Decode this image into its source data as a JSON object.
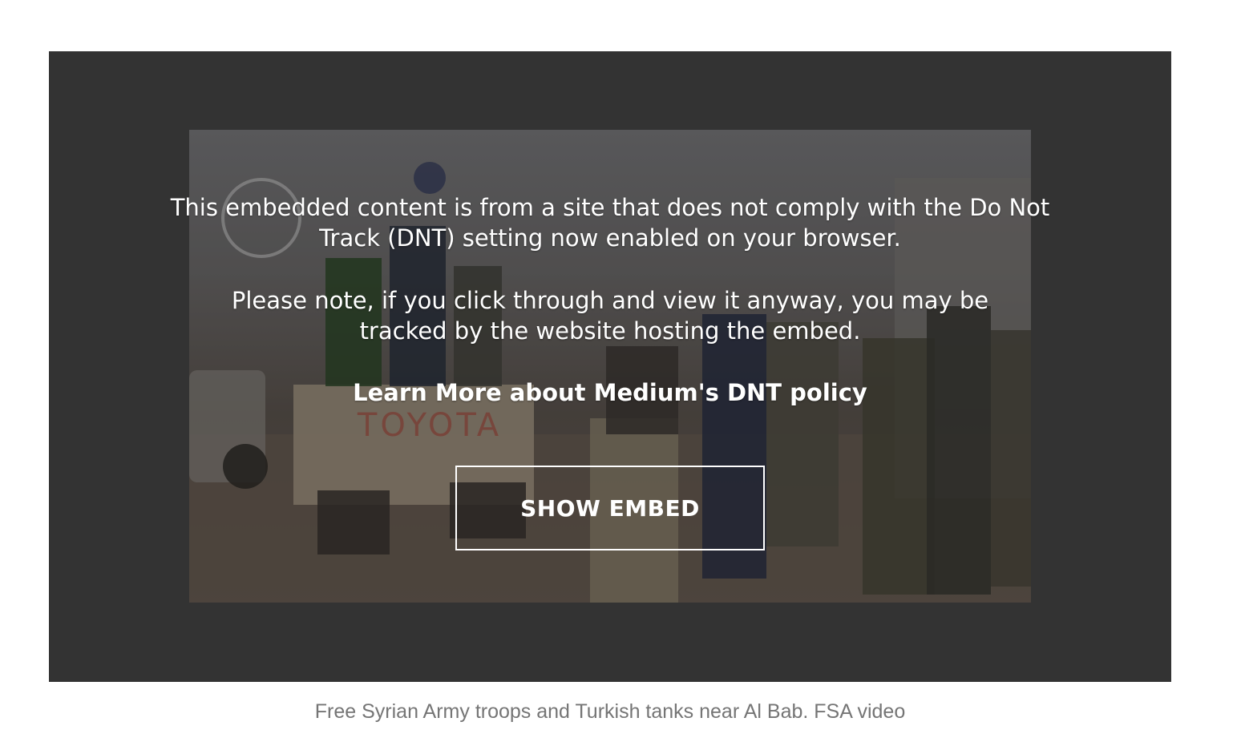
{
  "embed": {
    "notice_line1": "This embedded content is from a site that does not comply with the Do Not Track (DNT) setting now enabled on your browser.",
    "notice_line2": "Please note, if you click through and view it anyway, you may be tracked by the website hosting the embed.",
    "learn_more_label": "Learn More about Medium's DNT policy",
    "show_embed_label": "SHOW EMBED",
    "thumbnail_text": "TOYOTA"
  },
  "caption": {
    "text": "Free Syrian Army troops and Turkish tanks near Al Bab. FSA video"
  },
  "colors": {
    "frame_background": "#333333",
    "overlay_text": "#ffffff",
    "caption_text": "#757575"
  }
}
